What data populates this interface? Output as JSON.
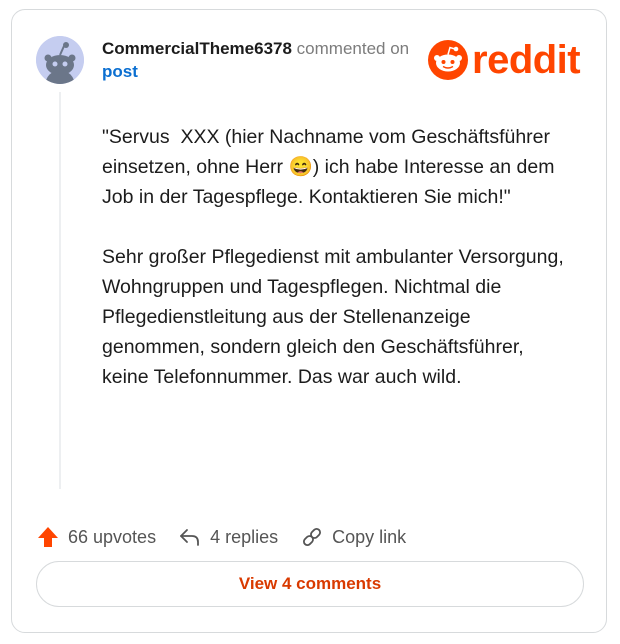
{
  "comment": {
    "username": "CommercialTheme6378",
    "action": "commented on",
    "post_link": "post",
    "brand": "reddit",
    "paragraphs": [
      "\"Servus  XXX (hier Nachname vom Geschäftsführer einsetzen, ohne Herr 😄) ich habe Interesse an dem Job in der Tagespflege. Kontaktieren Sie mich!\"",
      "Sehr großer Pflegedienst mit ambulanter Versorgung, Wohngruppen und Tagespflegen. Nichtmal die Pflegedienstleitung aus der Stellenanzeige genommen, sondern gleich den Geschäftsführer, keine Telefonnummer. Das war auch wild."
    ],
    "upvotes": "66 upvotes",
    "replies": "4 replies",
    "copy_link": "Copy link",
    "view_comments": "View 4 comments"
  },
  "colors": {
    "brand": "#ff4500",
    "link": "#0b6fd1",
    "button_text": "#d93a00",
    "avatar_bg": "#c5cdf0"
  },
  "icons": [
    "snoo-avatar-icon",
    "reddit-logo-icon",
    "upvote-arrow-icon",
    "reply-icon",
    "link-icon"
  ]
}
